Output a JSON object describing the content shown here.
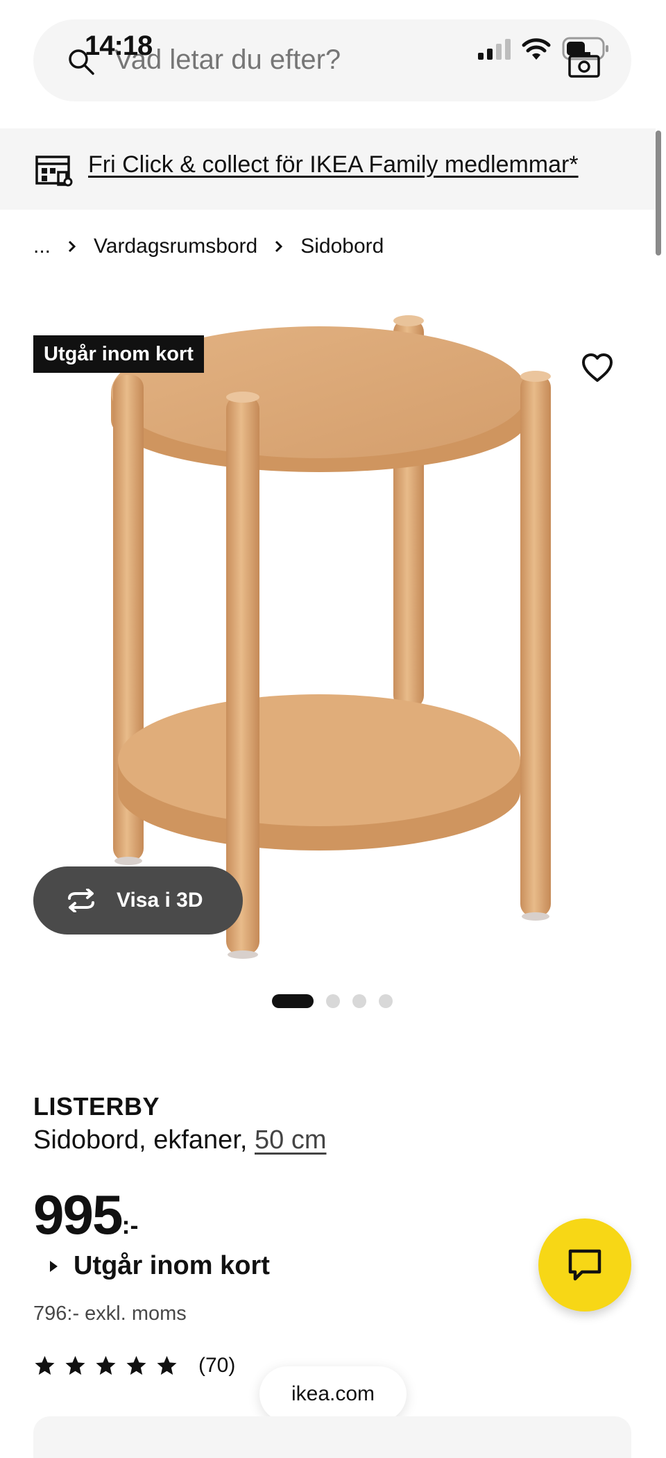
{
  "status_bar": {
    "time": "14:18"
  },
  "search": {
    "placeholder": "Vad letar du efter?"
  },
  "promo_banner": {
    "text": "Fri Click & collect för IKEA Family medlemmar*"
  },
  "breadcrumb": {
    "items": [
      "...",
      "Vardagsrumsbord",
      "Sidobord"
    ]
  },
  "product_image": {
    "badge": "Utgår inom kort",
    "view_3d_label": "Visa i 3D",
    "carousel": {
      "count": 4,
      "active_index": 0
    }
  },
  "product": {
    "name": "LISTERBY",
    "description": "Sidobord, ekfaner,",
    "size": "50 cm",
    "price": "995",
    "price_suffix": ":-",
    "availability": "Utgår inom kort",
    "excl_vat": "796:- exkl. moms",
    "rating_stars": 5,
    "review_count": "(70)"
  },
  "browser": {
    "domain": "ikea.com"
  },
  "colors": {
    "accent_yellow": "#f7d716",
    "badge_bg": "#111111",
    "wood": "#d9a572"
  },
  "icons": [
    "search-icon",
    "camera-icon",
    "store-icon",
    "heart-icon",
    "rotate-3d-icon",
    "chat-icon",
    "star-icon",
    "chevron-right-icon",
    "triangle-right-icon"
  ]
}
